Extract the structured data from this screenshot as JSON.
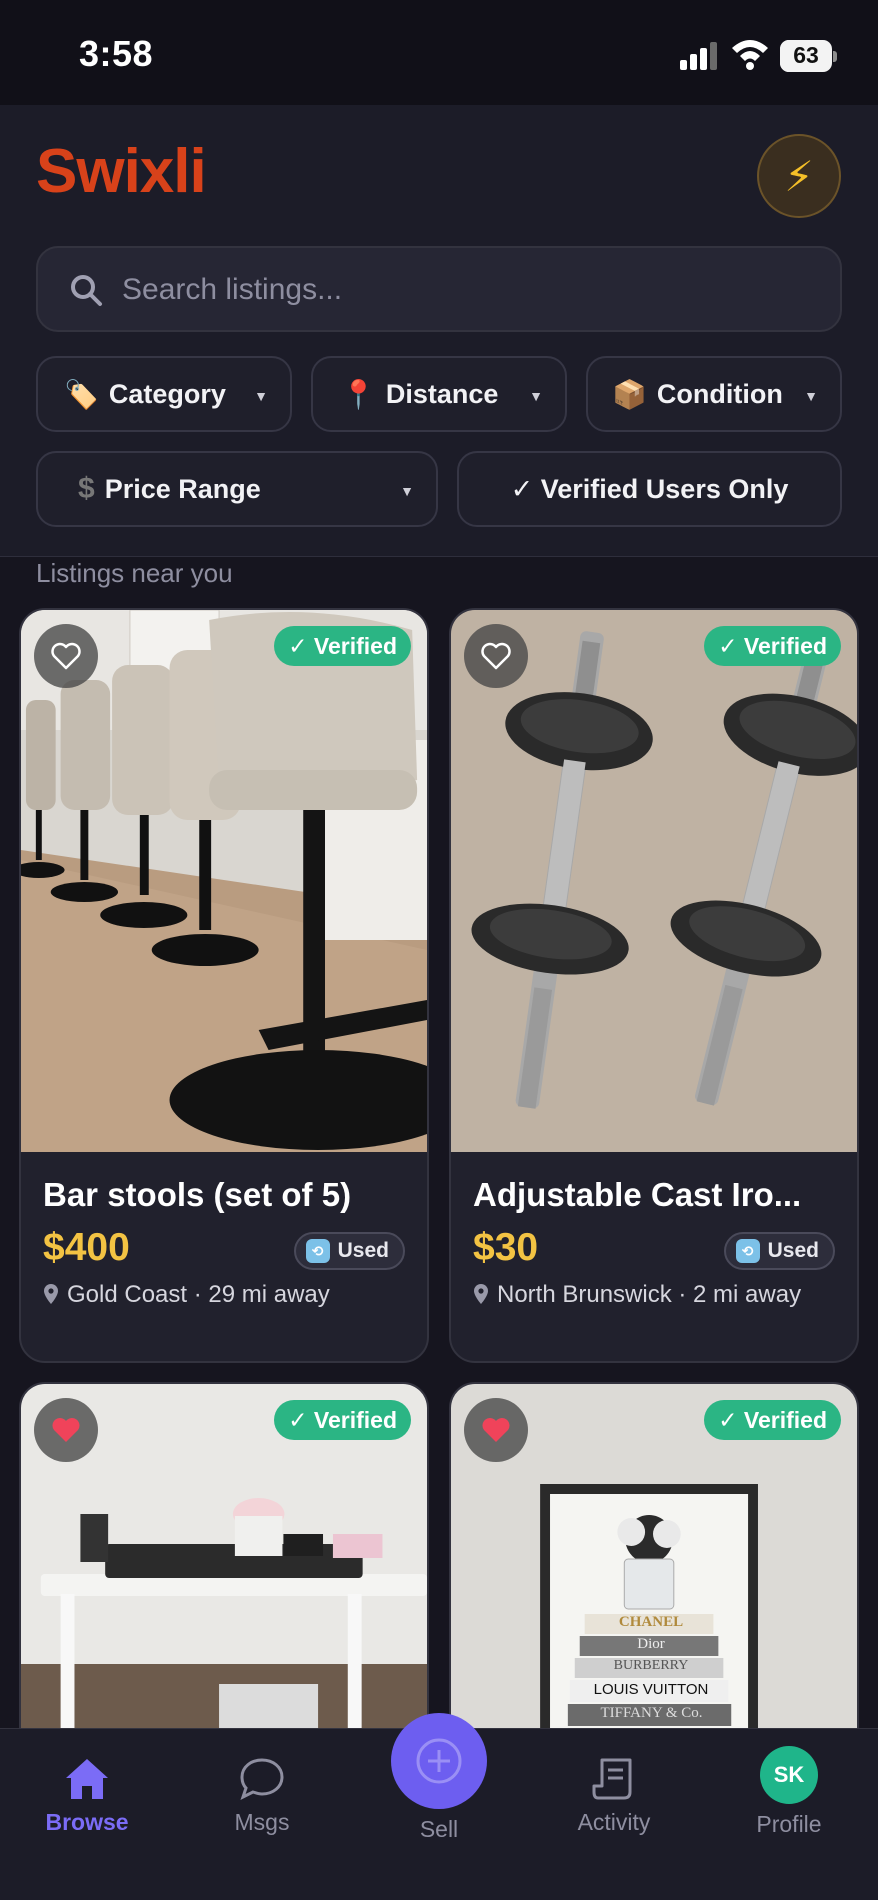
{
  "status_bar": {
    "time": "3:58",
    "battery": "63",
    "battery_level": 0.63
  },
  "header": {
    "logo": "Swixli",
    "search_placeholder": "Search listings...",
    "filters": [
      {
        "emoji": "🏷️",
        "label": "Category"
      },
      {
        "emoji": "📍",
        "label": "Distance"
      },
      {
        "emoji": "📦",
        "label": "Condition"
      },
      {
        "emoji": "$",
        "label": "Price Range"
      },
      {
        "emoji": "",
        "label": "✓ Verified Users Only"
      }
    ]
  },
  "section_title": "Listings near you",
  "listings": [
    {
      "title": "Bar stools (set of 5)",
      "price": "$400",
      "condition": "Used",
      "location": "Gold Coast · 29 mi away",
      "verified": "✓ Verified",
      "favorited": false,
      "image_icon": "bar-stools-photo"
    },
    {
      "title": "Adjustable Cast Iro...",
      "price": "$30",
      "condition": "Used",
      "location": "North Brunswick · 2 mi away",
      "verified": "✓ Verified",
      "favorited": false,
      "image_icon": "dumbbells-photo"
    },
    {
      "title": "",
      "price": "",
      "condition": "",
      "location": "",
      "verified": "✓ Verified",
      "favorited": true,
      "image_icon": "standing-desk-photo"
    },
    {
      "title": "",
      "price": "",
      "condition": "",
      "location": "",
      "verified": "✓ Verified",
      "favorited": true,
      "image_icon": "fashion-print-photo",
      "print_text": [
        "CHANEL",
        "Dior",
        "BURBERRY",
        "LOUIS VUITTON",
        "TIFFANY & Co."
      ]
    }
  ],
  "tabbar": {
    "tabs": [
      {
        "label": "Browse",
        "icon": "home-icon",
        "active": true
      },
      {
        "label": "Msgs",
        "icon": "message-icon",
        "active": false
      },
      {
        "label": "Sell",
        "icon": "plus-circle-icon",
        "active": false
      },
      {
        "label": "Activity",
        "icon": "receipt-icon",
        "active": false
      },
      {
        "label": "Profile",
        "icon": "avatar",
        "active": false,
        "initials": "SK"
      }
    ]
  },
  "colors": {
    "accent": "#6d5ef0",
    "verified": "#2bb584",
    "price": "#f3c343",
    "logo": "#d8421a"
  }
}
